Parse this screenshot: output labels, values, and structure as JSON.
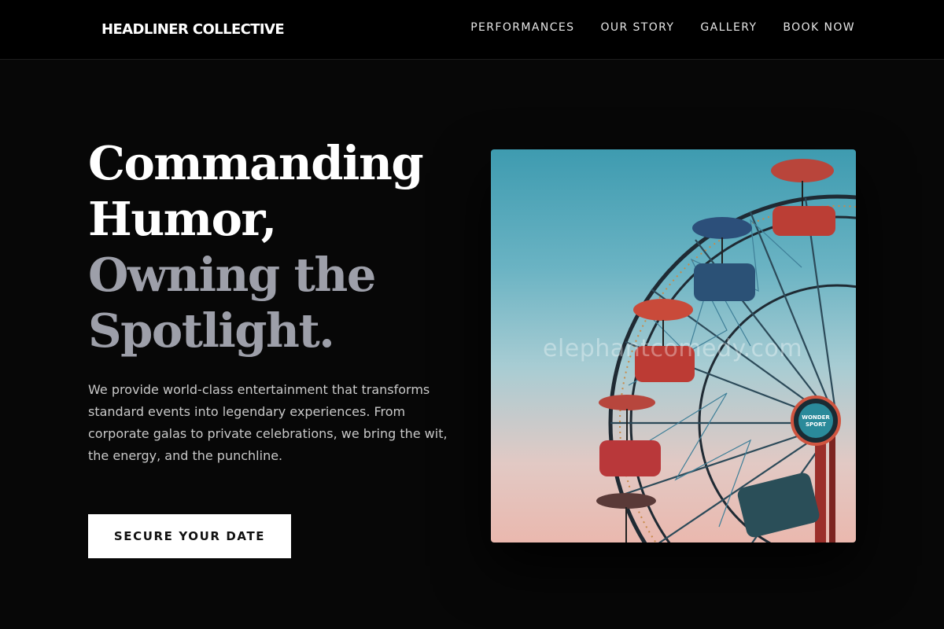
{
  "header": {
    "brand": "HEADLINER COLLECTIVE",
    "nav": [
      {
        "label": "PERFORMANCES"
      },
      {
        "label": "OUR STORY"
      },
      {
        "label": "GALLERY"
      },
      {
        "label": "BOOK NOW"
      }
    ]
  },
  "hero": {
    "title_lines": [
      "Commanding",
      "Humor,",
      "Owning the",
      "Spotlight."
    ],
    "description": "We provide world-class entertainment that transforms standard events into legendary experiences. From corporate galas to private celebrations, we bring the wit, the energy, and the punchline.",
    "cta_label": "SECURE YOUR DATE"
  },
  "image": {
    "subject": "ferris-wheel",
    "watermark": "elephantcomedy.com",
    "sign_text": "WONDER SPORT"
  },
  "colors": {
    "background": "#070707",
    "header_bg": "#000000",
    "title_primary": "#ffffff",
    "title_muted": "#9d9fa9",
    "body_text": "#c9c9c9",
    "cta_bg": "#ffffff",
    "cta_text": "#111111"
  }
}
